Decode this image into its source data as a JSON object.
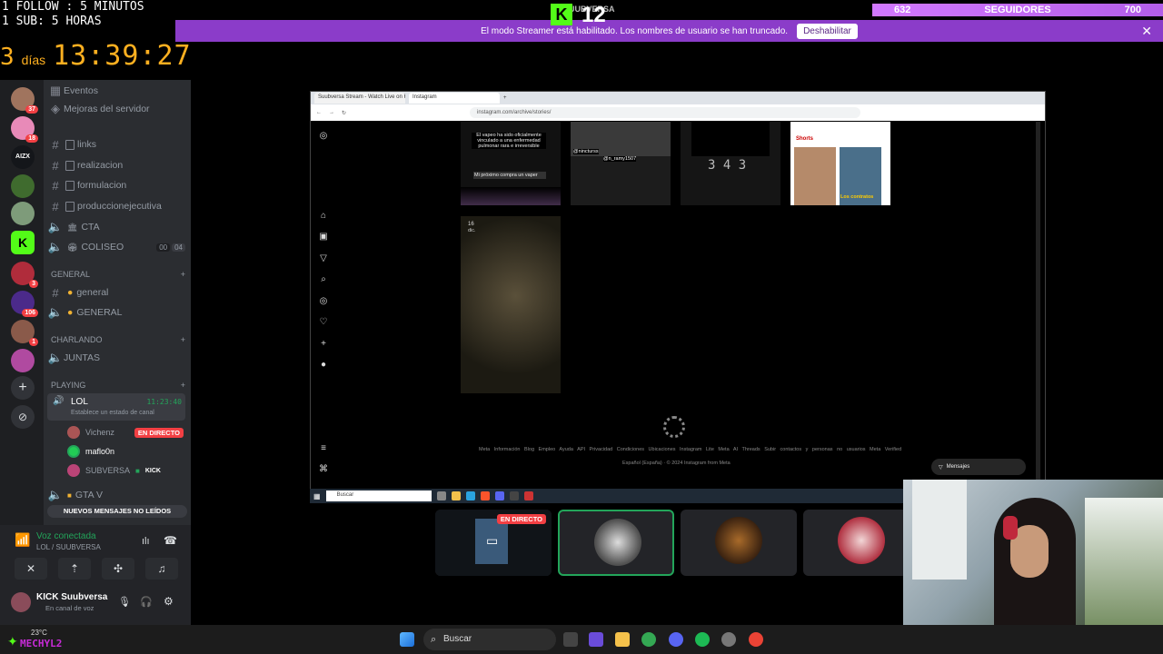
{
  "overlay": {
    "follow_line": "1 FOLLOW : 5 MINUTOS",
    "sub_line": "1 SUB: 5 HORAS",
    "days_num": "3",
    "days_word": "días",
    "timer": "13:39:27",
    "kick_count": "12",
    "kick_name": "SUUBVERSA",
    "followers_current": "632",
    "followers_label": "SEGUIDORES",
    "followers_goal": "700",
    "weather": "23°C",
    "bottom_name": "MECHYL2"
  },
  "streamer_bar": {
    "message": "El modo Streamer está habilitado. Los nombres de usuario se han truncado.",
    "disable_label": "Deshabilitar"
  },
  "server_rail": {
    "badges": [
      "37",
      "18",
      "3",
      "106",
      "1"
    ],
    "aizx_label": "AIZX"
  },
  "channels": {
    "events": "Eventos",
    "improvements": "Mejoras del servidor",
    "text_channels": [
      "links",
      "realizacion",
      "formulacion",
      "produccionejecutiva"
    ],
    "voice_cta": "CTA",
    "voice_coliseo": "COLISEO",
    "coliseo_count_a": "00",
    "coliseo_count_b": "04",
    "cat_general": "GENERAL",
    "general_text": "general",
    "general_voice": "GENERAL",
    "cat_charlando": "CHARLANDO",
    "juntas": "JUNTAS",
    "cat_playing": "PLAYING",
    "lol": "LOL",
    "lol_time": "11:23:40",
    "lol_status": "Establece un estado de canal",
    "members": [
      {
        "name": "Vichenz",
        "badge": "EN DIRECTO"
      },
      {
        "name": "maflo0n",
        "badge": ""
      },
      {
        "name": "SUBVERSA",
        "badge": "KICK"
      }
    ],
    "gtav": "GTA V",
    "new_msgs": "NUEVOS MENSAJES NO LEÍDOS"
  },
  "voice_panel": {
    "status": "Voz conectada",
    "channel": "LOL / SUUBVERSA",
    "user_name": "KICK Suubversa",
    "user_status": "En canal de voz"
  },
  "browser": {
    "tab1": "Suubversa Stream - Watch Live on Kick",
    "tab2": "Instagram",
    "url": "instagram.com/archive/stories/",
    "story_text_1": "El vapeo ha sido oficialmente vinculado a una enfermedad pulmonar rara e irreversible",
    "story_text_2": "Mi próximo compra un vaper",
    "story_tag_1": "@nincturss",
    "story_tag_2": "@n_ramy1507",
    "story_counter": "3 4 3",
    "shorts_label": "Shorts",
    "shorts_caption": "Los contratos",
    "story_date_day": "16",
    "story_date_month": "dic.",
    "footer_links": "Meta  Información  Blog  Empleo  Ayuda  API  Privacidad  Condiciones  Ubicaciones  Instagram Lite  Meta AI  Threads  Subir contactos y personas no usuarios  Meta Verified",
    "footer_lang": "Español (España)  ·  © 2024 Instagram from Meta",
    "messages_label": "Mensajes",
    "inner_search": "Buscar"
  },
  "stream_tiles": {
    "live_label": "EN DIRECTO"
  },
  "taskbar": {
    "search": "Buscar"
  }
}
